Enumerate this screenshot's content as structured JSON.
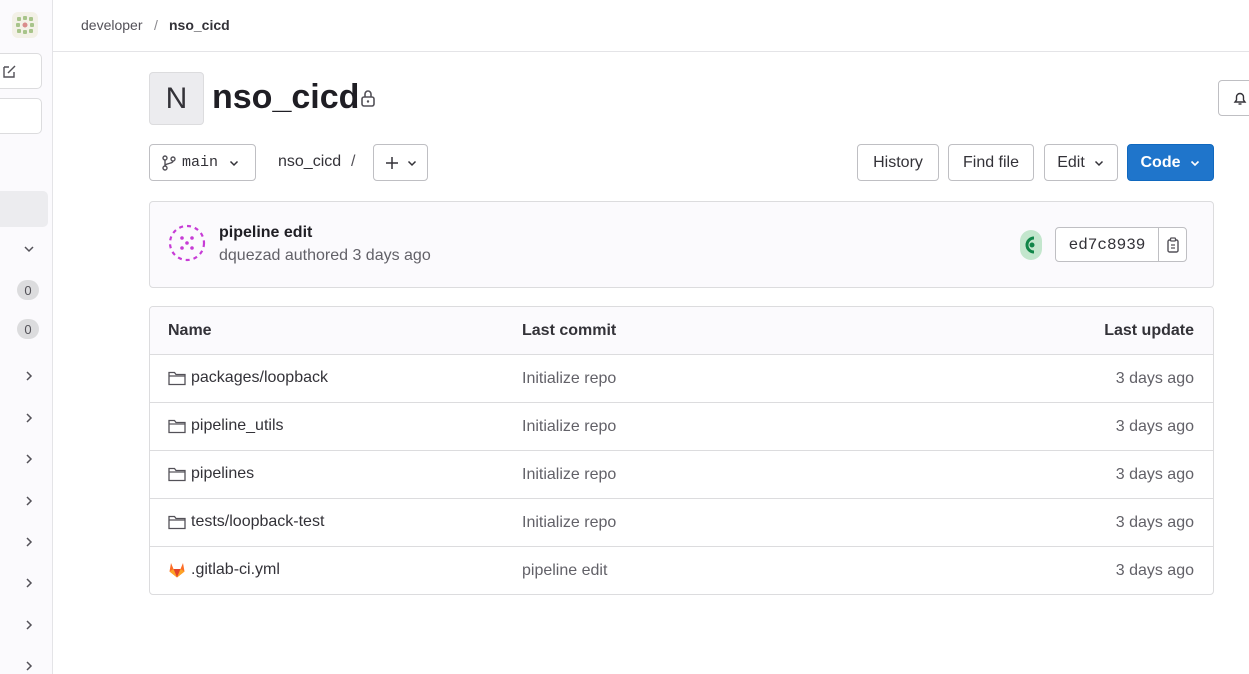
{
  "breadcrumb": {
    "group": "developer",
    "separator": "/",
    "project": "nso_cicd"
  },
  "sidebar": {
    "counts": [
      "0",
      "0"
    ]
  },
  "project": {
    "initial": "N",
    "name": "nso_cicd"
  },
  "controls": {
    "branch": "main",
    "path_root": "nso_cicd",
    "path_sep": "/",
    "history": "History",
    "find_file": "Find file",
    "edit": "Edit",
    "code": "Code"
  },
  "commit": {
    "title": "pipeline edit",
    "author_line": "dquezad authored 3 days ago",
    "sha": "ed7c8939",
    "status_color": "#108548"
  },
  "table": {
    "headers": {
      "name": "Name",
      "last_commit": "Last commit",
      "last_update": "Last update"
    },
    "rows": [
      {
        "name": "packages/loopback",
        "icon": "folder-icon",
        "commit": "Initialize repo",
        "updated": "3 days ago"
      },
      {
        "name": "pipeline_utils",
        "icon": "folder-icon",
        "commit": "Initialize repo",
        "updated": "3 days ago"
      },
      {
        "name": "pipelines",
        "icon": "folder-icon",
        "commit": "Initialize repo",
        "updated": "3 days ago"
      },
      {
        "name": "tests/loopback-test",
        "icon": "folder-icon",
        "commit": "Initialize repo",
        "updated": "3 days ago"
      },
      {
        "name": ".gitlab-ci.yml",
        "icon": "gitlab-file-icon",
        "commit": "pipeline edit",
        "updated": "3 days ago"
      }
    ]
  },
  "colors": {
    "accent": "#1f75cb",
    "border": "#dcdcde",
    "muted_text": "#626168"
  }
}
